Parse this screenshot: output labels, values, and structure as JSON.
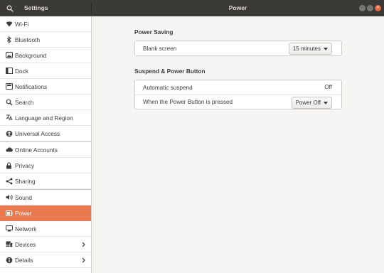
{
  "header": {
    "left_title": "Settings",
    "title": "Power"
  },
  "sidebar": {
    "items": [
      {
        "label": "Wi-Fi",
        "icon": "wifi-icon"
      },
      {
        "label": "Bluetooth",
        "icon": "bluetooth-icon"
      },
      {
        "label": "Background",
        "icon": "background-icon"
      },
      {
        "label": "Dock",
        "icon": "dock-icon"
      },
      {
        "label": "Notifications",
        "icon": "notifications-icon"
      },
      {
        "label": "Search",
        "icon": "search-icon"
      },
      {
        "label": "Language and Region",
        "icon": "language-icon"
      },
      {
        "label": "Universal Access",
        "icon": "universal-access-icon"
      },
      {
        "label": "Online Accounts",
        "icon": "online-accounts-icon"
      },
      {
        "label": "Privacy",
        "icon": "privacy-icon"
      },
      {
        "label": "Sharing",
        "icon": "sharing-icon"
      },
      {
        "label": "Sound",
        "icon": "sound-icon"
      },
      {
        "label": "Power",
        "icon": "power-icon"
      },
      {
        "label": "Network",
        "icon": "network-icon"
      },
      {
        "label": "Devices",
        "icon": "devices-icon"
      },
      {
        "label": "Details",
        "icon": "details-icon"
      }
    ],
    "selected": "Power"
  },
  "power_saving": {
    "title": "Power Saving",
    "blank_screen_label": "Blank screen",
    "blank_screen_value": "15 minutes"
  },
  "suspend": {
    "title": "Suspend & Power Button",
    "automatic_suspend_label": "Automatic suspend",
    "automatic_suspend_value": "Off",
    "power_button_label": "When the Power Button is pressed",
    "power_button_value": "Power Off"
  },
  "colors": {
    "accent": "#e9794e",
    "header": "#3b3a36",
    "close": "#e9643e"
  }
}
